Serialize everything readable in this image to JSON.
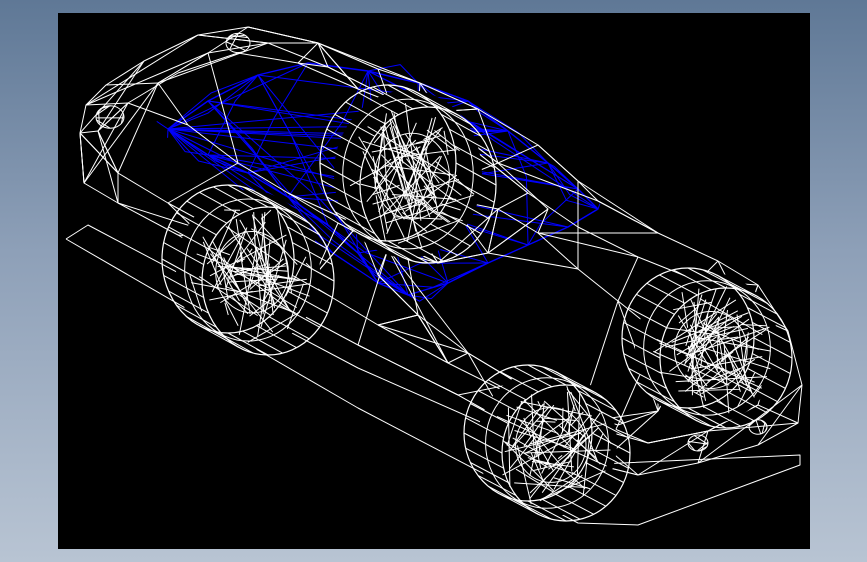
{
  "viewport": {
    "background": "#000000",
    "wire_color": "#ffffff",
    "interior_wire_color": "#0000ff",
    "frame_gradient": [
      "#5f7896",
      "#b8c4d3"
    ],
    "subject": "car-wireframe"
  }
}
